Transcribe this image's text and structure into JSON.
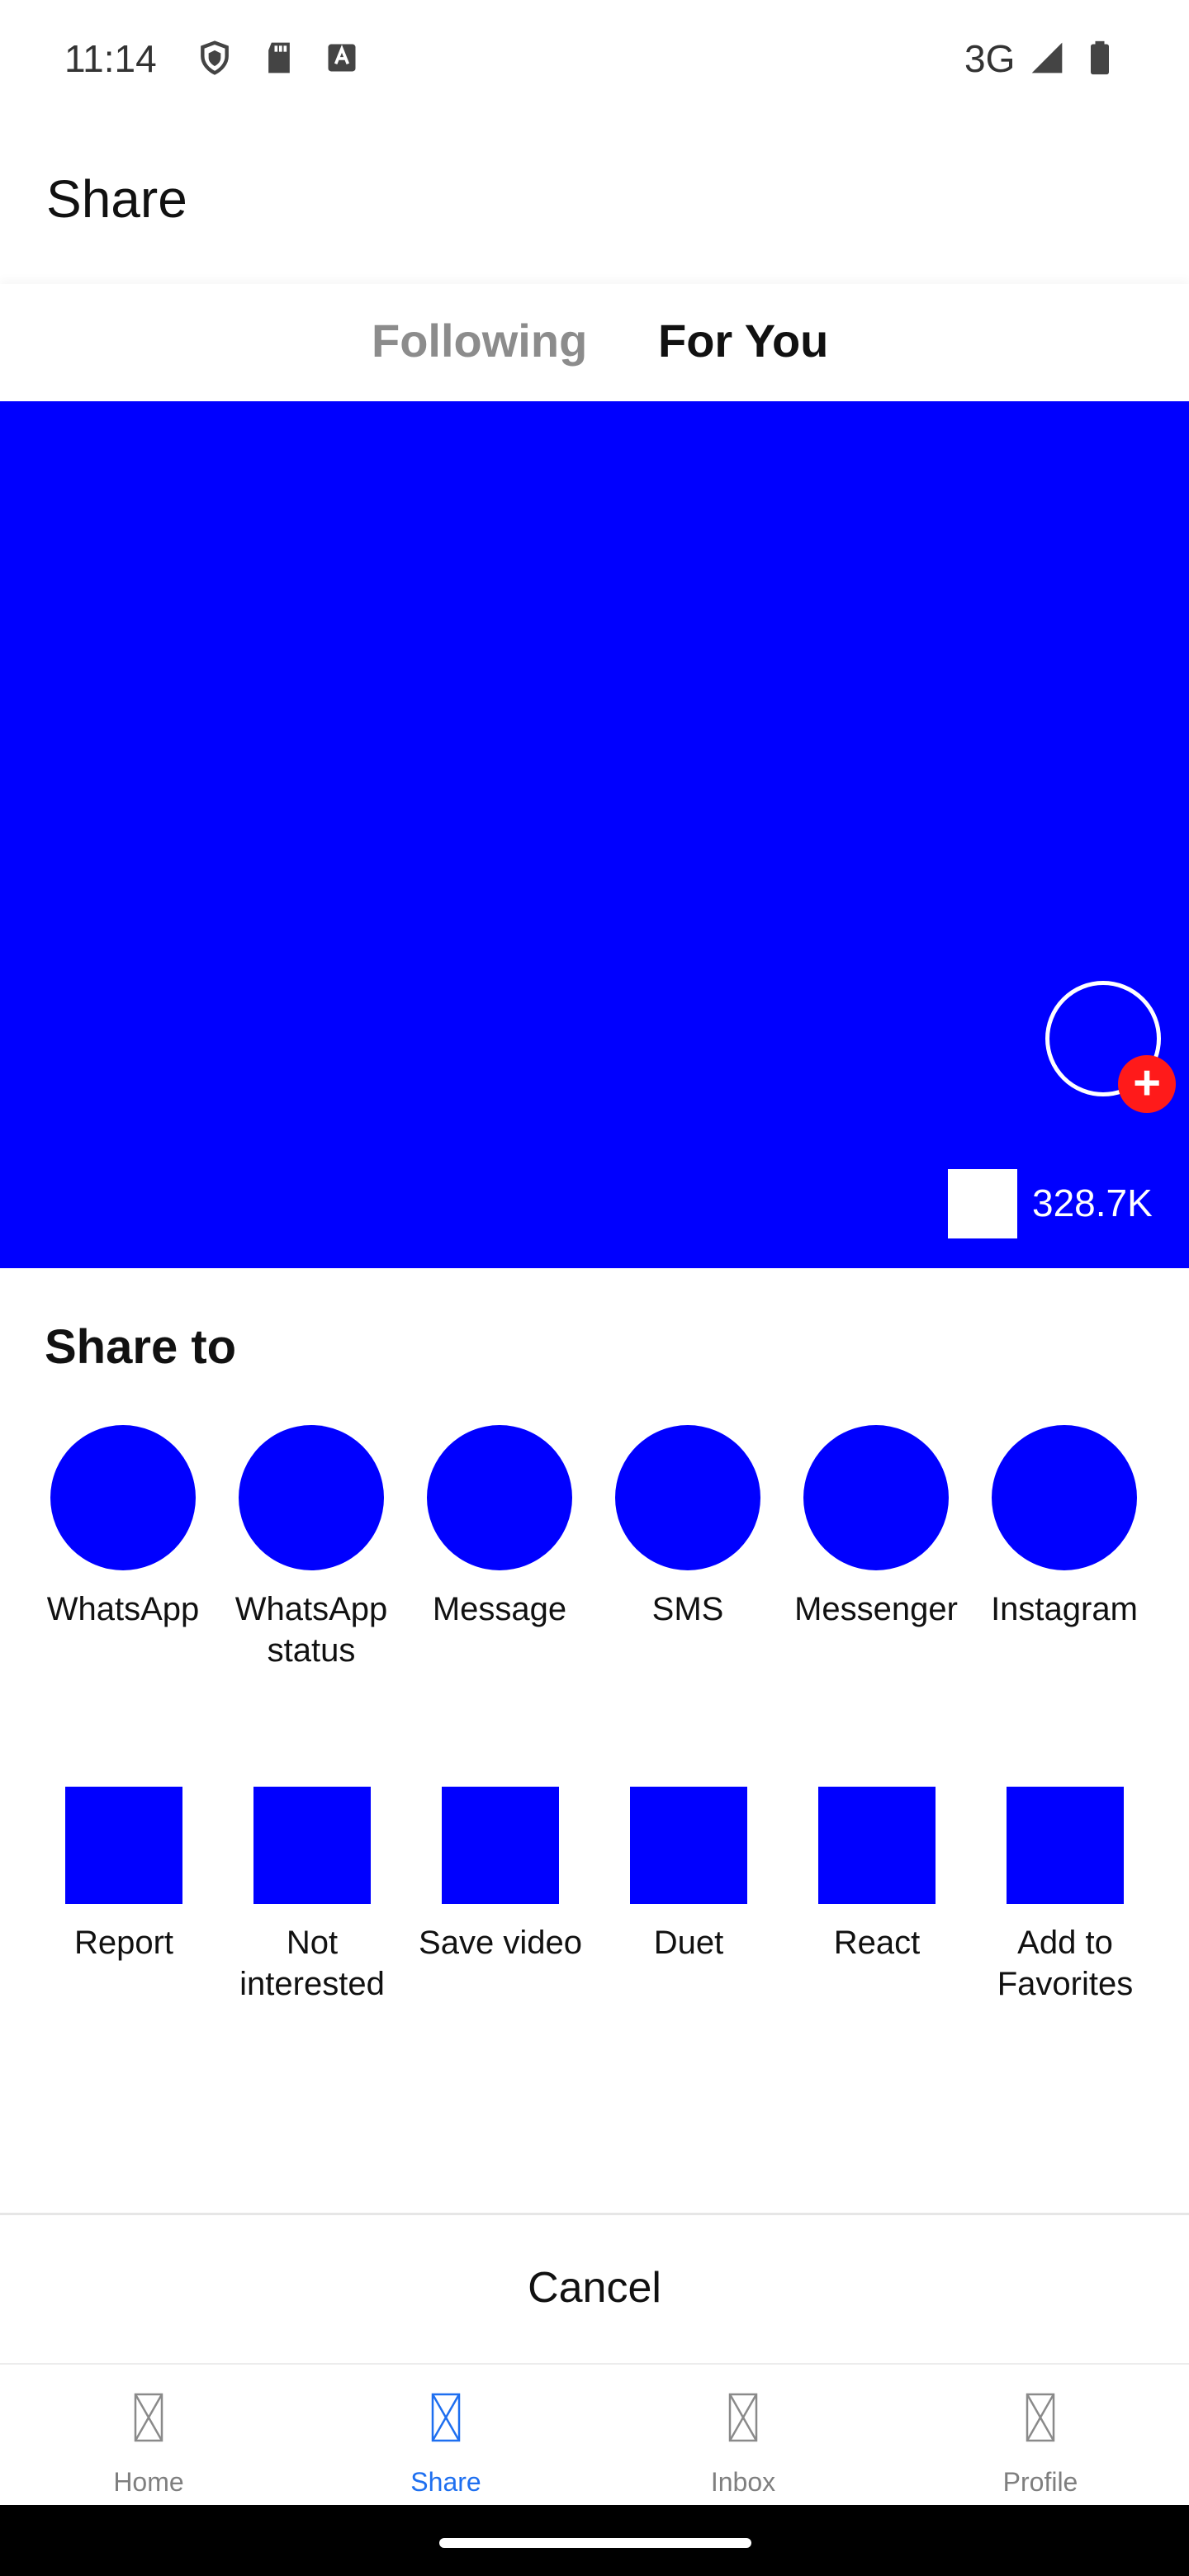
{
  "status_bar": {
    "time": "11:14",
    "network": "3G"
  },
  "header": {
    "title": "Share"
  },
  "tabs": [
    {
      "label": "Following",
      "active": false
    },
    {
      "label": "For You",
      "active": true
    }
  ],
  "video": {
    "like_count": "328.7K",
    "follow_symbol": "+"
  },
  "share_panel": {
    "title": "Share to",
    "targets": [
      {
        "label": "WhatsApp"
      },
      {
        "label": "WhatsApp status"
      },
      {
        "label": "Message"
      },
      {
        "label": "SMS"
      },
      {
        "label": "Messenger"
      },
      {
        "label": "Instagram"
      }
    ],
    "actions": [
      {
        "label": "Report"
      },
      {
        "label": "Not interested"
      },
      {
        "label": "Save video"
      },
      {
        "label": "Duet"
      },
      {
        "label": "React"
      },
      {
        "label": "Add to Favorites"
      }
    ],
    "cancel_label": "Cancel"
  },
  "bottom_nav": [
    {
      "label": "Home",
      "active": false
    },
    {
      "label": "Share",
      "active": true
    },
    {
      "label": "Inbox",
      "active": false
    },
    {
      "label": "Profile",
      "active": false
    }
  ],
  "colors": {
    "placeholder_blue": "#0000ff",
    "follow_red": "#ff1a1a",
    "active_nav": "#1e6ff0",
    "inactive_tab": "#8c8c8c"
  }
}
